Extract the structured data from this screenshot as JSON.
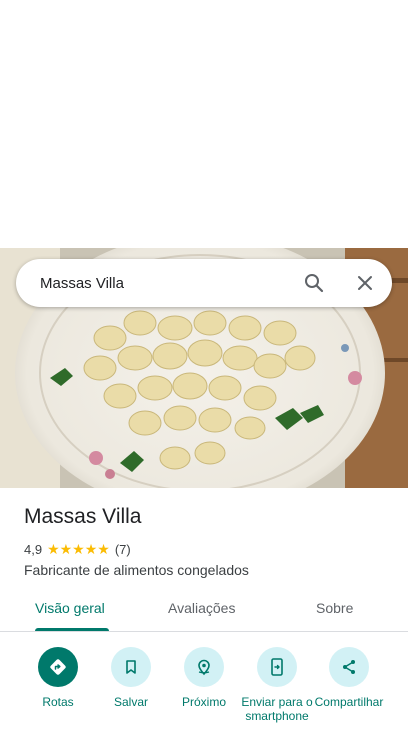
{
  "search": {
    "query": "Massas Villa"
  },
  "place": {
    "name": "Massas Villa",
    "rating": "4,9",
    "stars": "★★★★★",
    "review_count": "(7)",
    "category": "Fabricante de alimentos congelados"
  },
  "tabs": [
    {
      "label": "Visão geral",
      "active": true
    },
    {
      "label": "Avaliações",
      "active": false
    },
    {
      "label": "Sobre",
      "active": false
    }
  ],
  "actions": [
    {
      "label": "Rotas",
      "icon": "directions-icon"
    },
    {
      "label": "Salvar",
      "icon": "bookmark-icon"
    },
    {
      "label": "Próximo",
      "icon": "nearby-icon"
    },
    {
      "label": "Enviar para o smartphone",
      "icon": "send-to-phone-icon"
    },
    {
      "label": "Compartilhar",
      "icon": "share-icon"
    }
  ],
  "colors": {
    "accent": "#00796b",
    "accent_light": "#d2f1f5",
    "star": "#fbbc04"
  }
}
